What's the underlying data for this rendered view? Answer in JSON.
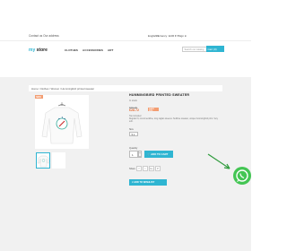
{
  "header": {
    "contact": "Contact us Our address",
    "language": "English ▾",
    "currency": "Currency: EUR € ▾",
    "sign_in": "Sign in",
    "cart": "Cart (0)"
  },
  "logo": {
    "prefix": "my",
    "suffix": " store"
  },
  "nav": [
    "CLOTHES",
    "ACCESSORIES",
    "ART"
  ],
  "search": {
    "placeholder": "Search our catalog"
  },
  "cart_button": "Cart (0)",
  "breadcrumb": "Home  /  Clothes  /  Women  /  Hummingbird printed sweater",
  "product": {
    "badge": "NEW",
    "title": "HUMMINGBIRD PRINTED SWEATER",
    "in_stock": "In stock",
    "old_price": "€35.90",
    "price": "€28.72",
    "save": "SAVE 20%",
    "tax": "Tax included",
    "description": "Regular fit, round neckline, long raglan sleeves. Sublime sweater, unique hummingbird print. Very soft.",
    "size_label": "Size",
    "size_value": "S ▾",
    "qty_label": "Quantity",
    "qty_value": "1",
    "add_to_cart": "🛒  ADD TO CART",
    "share_label": "Share",
    "wishlist": "♥  ADD TO WISHLIST"
  },
  "share_icons": [
    "f",
    "t",
    "G+",
    "P"
  ],
  "colors": {
    "accent": "#2fb5d2",
    "price": "#e66e36",
    "badge": "#f39d72",
    "whatsapp": "#43c553"
  }
}
